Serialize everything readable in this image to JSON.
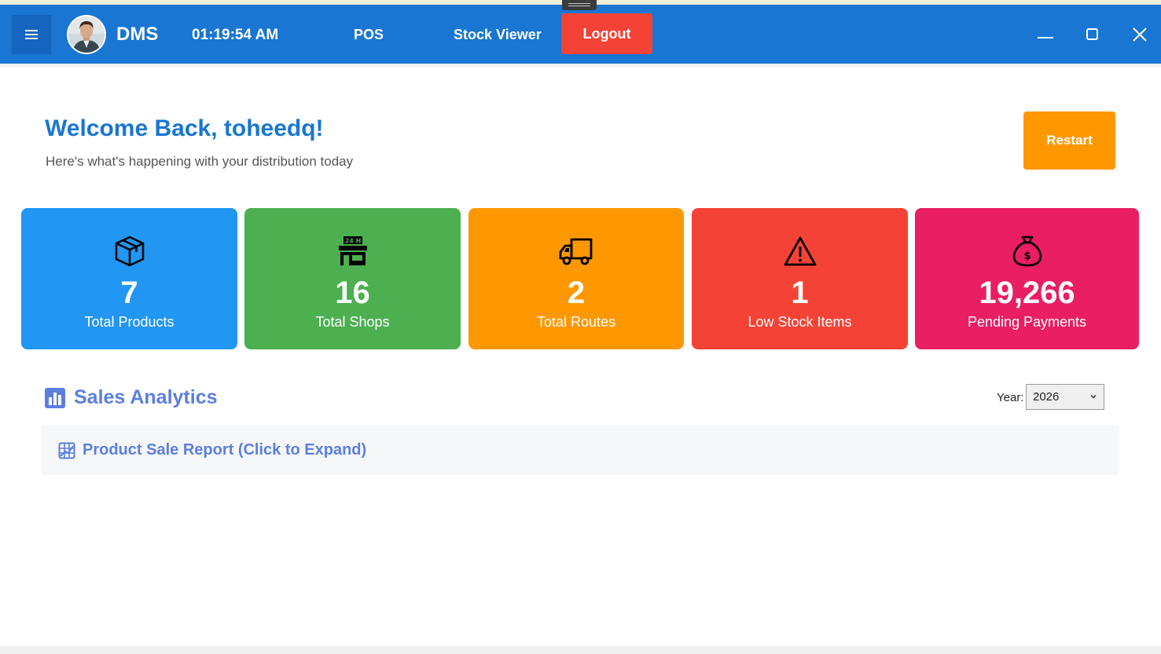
{
  "header": {
    "app_name": "DMS",
    "clock": "01:19:54 AM",
    "nav": [
      {
        "label": "POS"
      },
      {
        "label": "Stock Viewer"
      }
    ],
    "logout_label": "Logout",
    "icons": {
      "menu": "hamburger-icon",
      "avatar": "user-avatar",
      "minimize": "minimize-icon",
      "maximize": "maximize-icon",
      "close": "close-icon"
    },
    "colors": {
      "bar": "#1976d2",
      "logout": "#f44336"
    }
  },
  "welcome": {
    "title": "Welcome Back, toheedq!",
    "subtitle": "Here's what's happening with your distribution today",
    "restart_label": "Restart",
    "restart_color": "#ff9800"
  },
  "stats": [
    {
      "value": "7",
      "label": "Total Products",
      "icon": "box-icon",
      "color": "#2196f3"
    },
    {
      "value": "16",
      "label": "Total Shops",
      "icon": "store-24h-icon",
      "color": "#4caf50"
    },
    {
      "value": "2",
      "label": "Total Routes",
      "icon": "truck-icon",
      "color": "#ff9800"
    },
    {
      "value": "1",
      "label": "Low Stock Items",
      "icon": "warning-icon",
      "color": "#f44336"
    },
    {
      "value": "19,266",
      "label": "Pending Payments",
      "icon": "money-bag-icon",
      "color": "#e91e63"
    }
  ],
  "analytics": {
    "title": "Sales Analytics",
    "icon": "bar-chart-icon",
    "year_label": "Year:",
    "year_value": "2026",
    "report_title": "Product Sale Report (Click to Expand)",
    "report_icon": "grid-chart-icon",
    "accent": "#5c7ee0"
  }
}
